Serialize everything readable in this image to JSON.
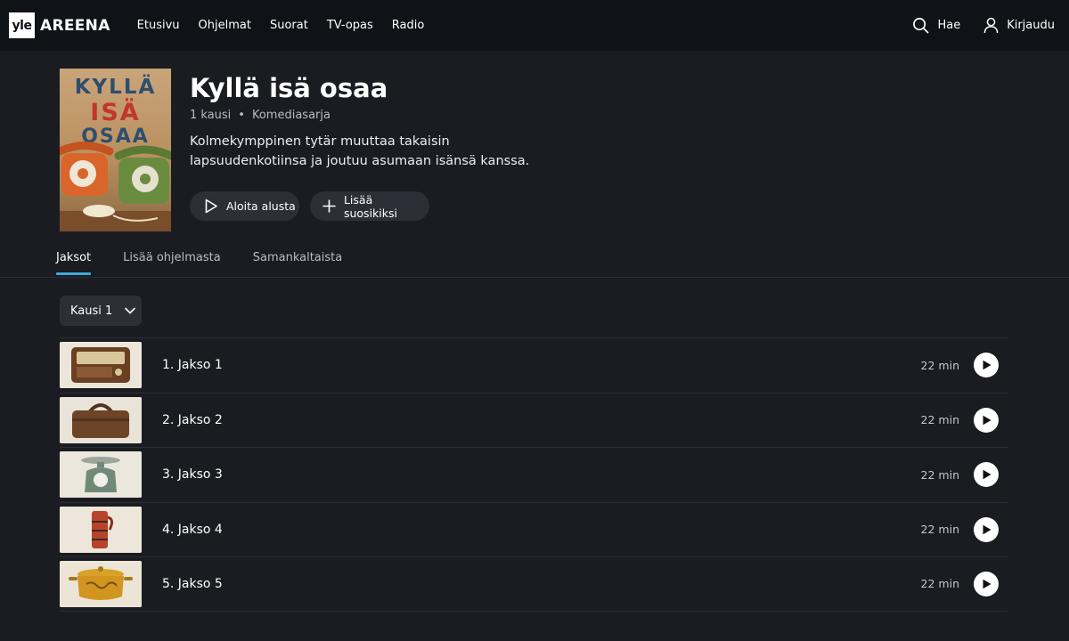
{
  "brand": {
    "logo_small": "yle",
    "logo_text": "AREENA"
  },
  "nav": {
    "links": [
      "Etusivu",
      "Ohjelmat",
      "Suorat",
      "TV-opas",
      "Radio"
    ],
    "search_label": "Hae",
    "login_label": "Kirjaudu"
  },
  "show": {
    "cover_words": [
      "KYLLÄ",
      "ISÄ",
      "OSAA"
    ],
    "title": "Kyllä isä osaa",
    "seasons": "1 kausi",
    "genre": "Komediasarja",
    "description": "Kolmekymppinen tytär muuttaa takaisin lapsuudenkotiinsa ja joutuu asumaan isänsä kanssa.",
    "start_label": "Aloita alusta",
    "favorite_label": "Lisää suosikiksi"
  },
  "tabs": [
    {
      "label": "Jaksot",
      "active": true
    },
    {
      "label": "Lisää ohjelmasta",
      "active": false
    },
    {
      "label": "Samankaltaista",
      "active": false
    }
  ],
  "season_select": {
    "label": "Kausi 1"
  },
  "episodes": [
    {
      "title": "1. Jakso 1",
      "duration": "22 min",
      "thumb": "radio"
    },
    {
      "title": "2. Jakso 2",
      "duration": "22 min",
      "thumb": "bag"
    },
    {
      "title": "3. Jakso 3",
      "duration": "22 min",
      "thumb": "scale"
    },
    {
      "title": "4. Jakso 4",
      "duration": "22 min",
      "thumb": "thermos"
    },
    {
      "title": "5. Jakso 5",
      "duration": "22 min",
      "thumb": "pot"
    }
  ],
  "colors": {
    "accent": "#3ea8d8",
    "background": "#1a1c22",
    "nav": "#0f1217",
    "button": "#2c2f36"
  }
}
